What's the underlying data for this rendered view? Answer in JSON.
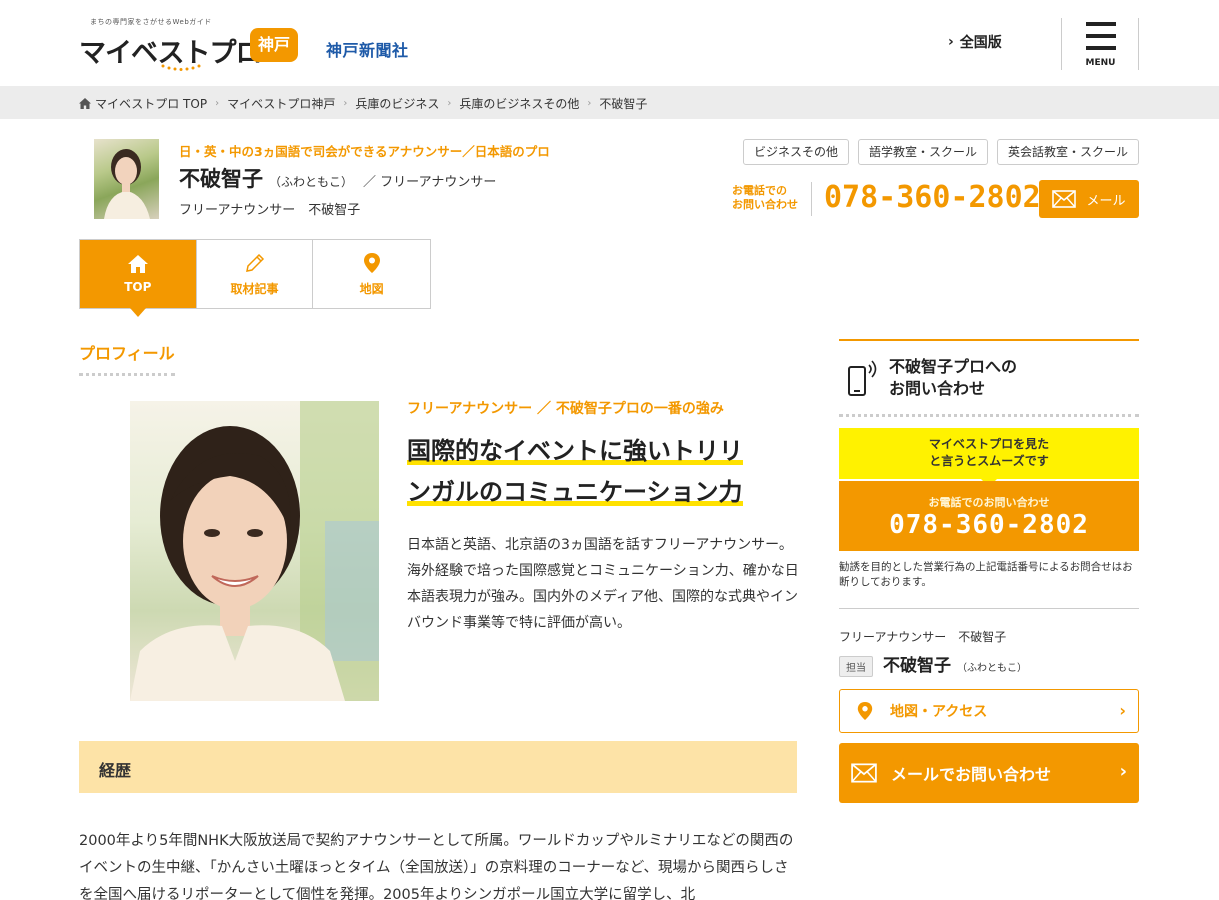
{
  "header": {
    "tagline": "まちの専門家をさがせるWebガイド",
    "logo": "マイベストプロ",
    "region": "神戸",
    "publisher": "神戸新聞社",
    "national_link": "全国版",
    "menu_label": "MENU"
  },
  "breadcrumb": [
    "マイベストプロ TOP",
    "マイベストプロ神戸",
    "兵庫のビジネス",
    "兵庫のビジネスその他",
    "不破智子"
  ],
  "profile": {
    "tagline": "日・英・中の3ヵ国語で司会ができるアナウンサー／日本語のプロ",
    "name": "不破智子",
    "kana": "（ふわともこ）",
    "title": "／ フリーアナウンサー",
    "subtitle": "フリーアナウンサー　不破智子"
  },
  "categories": [
    "ビジネスその他",
    "語学教室・スクール",
    "英会話教室・スクール"
  ],
  "contact": {
    "phone_label_1": "お電話での",
    "phone_label_2": "お問い合わせ",
    "phone": "078-360-2802",
    "mail_label": "メール"
  },
  "tabs": [
    {
      "label": "TOP",
      "icon": "home-icon",
      "active": true
    },
    {
      "label": "取材記事",
      "icon": "pencil-icon",
      "active": false
    },
    {
      "label": "地図",
      "icon": "map-pin-icon",
      "active": false
    }
  ],
  "main": {
    "section_title": "プロフィール",
    "strength_label": "フリーアナウンサー ／ 不破智子プロの一番の強み",
    "catch_line_1": "国際的なイベントに強いトリリ",
    "catch_line_2": "ンガルのコミュニケーション力",
    "intro": "日本語と英語、北京語の3ヵ国語を話すフリーアナウンサー。海外経験で培った国際感覚とコミュニケーション力、確かな日本語表現力が強み。国内外のメディア他、国際的な式典やインバウンド事業等で特に評価が高い。",
    "career_title": "経歴",
    "career_text": "2000年より5年間NHK大阪放送局で契約アナウンサーとして所属。ワールドカップやルミナリエなどの関西のイベントの生中継、「かんさい土曜ほっとタイム（全国放送）」の京料理のコーナーなど、現場から関西らしさを全国へ届けるリポーターとして個性を発揮。2005年よりシンガポール国立大学に留学し、北"
  },
  "sidebar": {
    "heading_1": "不破智子プロへの",
    "heading_2": "お問い合わせ",
    "notice_1": "マイベストプロを見た",
    "notice_2": "と言うとスムーズです",
    "call_label": "お電話でのお問い合わせ",
    "call_number": "078-360-2802",
    "disclaimer": "勧誘を目的とした営業行為の上記電話番号によるお問合せはお断りしております。",
    "pro_title": "フリーアナウンサー　不破智子",
    "badge": "担当",
    "name": "不破智子",
    "kana": "（ふわともこ）",
    "map_button": "地図・アクセス",
    "mail_button": "メールでお問い合わせ"
  },
  "colors": {
    "accent": "#f39800",
    "highlight": "#ffe100",
    "notice_bg": "#fff200",
    "career_bg": "#fde3a7",
    "publisher": "#1e5aa8"
  }
}
